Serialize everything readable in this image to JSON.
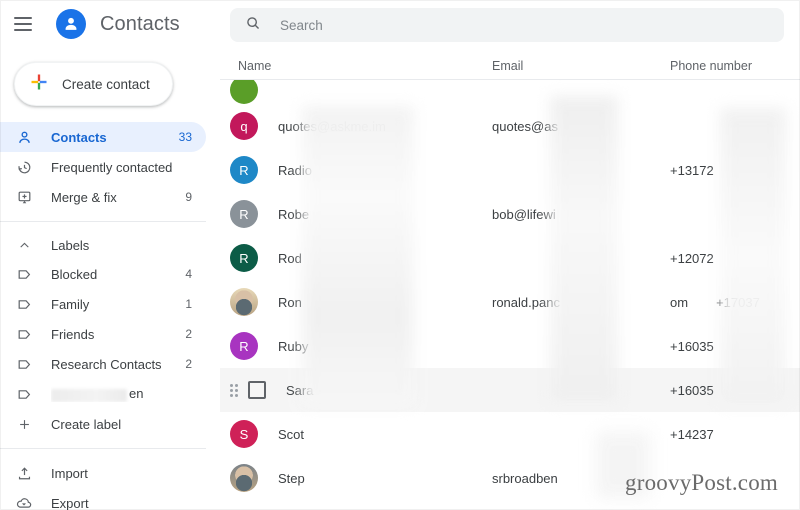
{
  "header": {
    "menu_icon": "hamburger-menu-icon",
    "app_icon": "contacts-person-icon",
    "title": "Contacts"
  },
  "sidebar": {
    "create_contact": {
      "label": "Create contact",
      "icon": "google-plus-icon"
    },
    "nav": [
      {
        "label": "Contacts",
        "count": "33",
        "icon": "person-outline-icon",
        "active": true
      },
      {
        "label": "Frequently contacted",
        "count": "",
        "icon": "history-clock-icon",
        "active": false
      },
      {
        "label": "Merge & fix",
        "count": "9",
        "icon": "merge-icon",
        "active": false
      }
    ],
    "labels_section": {
      "label": "Labels",
      "icon": "chevron-up-icon"
    },
    "labels": [
      {
        "label": "Blocked",
        "count": "4",
        "icon": "label-outline-icon",
        "blurred": false
      },
      {
        "label": "Family",
        "count": "1",
        "icon": "label-outline-icon",
        "blurred": false
      },
      {
        "label": "Friends",
        "count": "2",
        "icon": "label-outline-icon",
        "blurred": false
      },
      {
        "label": "Research Contacts",
        "count": "2",
        "icon": "label-outline-icon",
        "blurred": false
      },
      {
        "label": "en",
        "count": "",
        "icon": "label-outline-icon",
        "blurred": true
      }
    ],
    "create_label": {
      "label": "Create label",
      "icon": "plus-icon"
    },
    "footer": [
      {
        "label": "Import",
        "icon": "upload-icon"
      },
      {
        "label": "Export",
        "icon": "cloud-download-icon"
      }
    ]
  },
  "search": {
    "placeholder": "Search",
    "value": "",
    "icon": "search-icon"
  },
  "table": {
    "columns": {
      "name": "Name",
      "email": "Email",
      "phone": "Phone number"
    },
    "rows": [
      {
        "name": "",
        "email": "",
        "phone": "",
        "initial": "",
        "avatar_color": "#5a9e28",
        "avatar_type": "letter",
        "partial": true,
        "hover": false
      },
      {
        "name": "quotes@askme.im",
        "email": "quotes@as",
        "phone": "",
        "initial": "q",
        "avatar_color": "#c2185b",
        "avatar_type": "letter",
        "partial": false,
        "hover": false
      },
      {
        "name": "Radio",
        "email": "",
        "phone": "+13172",
        "initial": "R",
        "avatar_color": "#1e88c7",
        "avatar_type": "letter",
        "partial": false,
        "hover": false
      },
      {
        "name": "Robe",
        "email": "bob@lifewi",
        "phone": "",
        "initial": "R",
        "avatar_color": "#8a9299",
        "avatar_type": "letter",
        "partial": false,
        "hover": false
      },
      {
        "name": "Rod",
        "email": "",
        "phone": "+12072",
        "initial": "R",
        "avatar_color": "#0c5c47",
        "avatar_type": "letter",
        "partial": false,
        "hover": false
      },
      {
        "name": "Ron",
        "email": "ronald.panc",
        "email_tail": "om",
        "phone": "+17037",
        "initial": "",
        "avatar_color": "#e8d9b8",
        "avatar_type": "photo",
        "partial": false,
        "hover": false
      },
      {
        "name": "Ruby",
        "email": "",
        "phone": "+16035",
        "initial": "R",
        "avatar_color": "#a834c0",
        "avatar_type": "letter",
        "partial": false,
        "hover": false
      },
      {
        "name": "Sara",
        "email": "",
        "phone": "+16035",
        "initial": "",
        "avatar_color": "",
        "avatar_type": "checkbox",
        "partial": false,
        "hover": true
      },
      {
        "name": "Scot",
        "email": "",
        "phone": "+14237",
        "initial": "S",
        "avatar_color": "#cf2158",
        "avatar_type": "letter",
        "partial": false,
        "hover": false
      },
      {
        "name": "Step",
        "email": "srbroadben",
        "phone": "",
        "initial": "",
        "avatar_color": "#7b8288",
        "avatar_type": "photo",
        "partial": false,
        "hover": false
      }
    ],
    "row_controls": {
      "drag_handle": "drag-handle-icon",
      "checkbox": "row-checkbox"
    }
  },
  "watermark": {
    "text": "groovyPost.com"
  },
  "colors": {
    "accent_blue": "#1a73e8",
    "active_pill": "#e8f0fe",
    "active_text": "#1967d2",
    "text_primary": "#3c4043",
    "text_secondary": "#5f6368",
    "search_bg": "#f1f3f4",
    "hover_row": "#f5f5f5",
    "divider": "#e8eaed"
  }
}
